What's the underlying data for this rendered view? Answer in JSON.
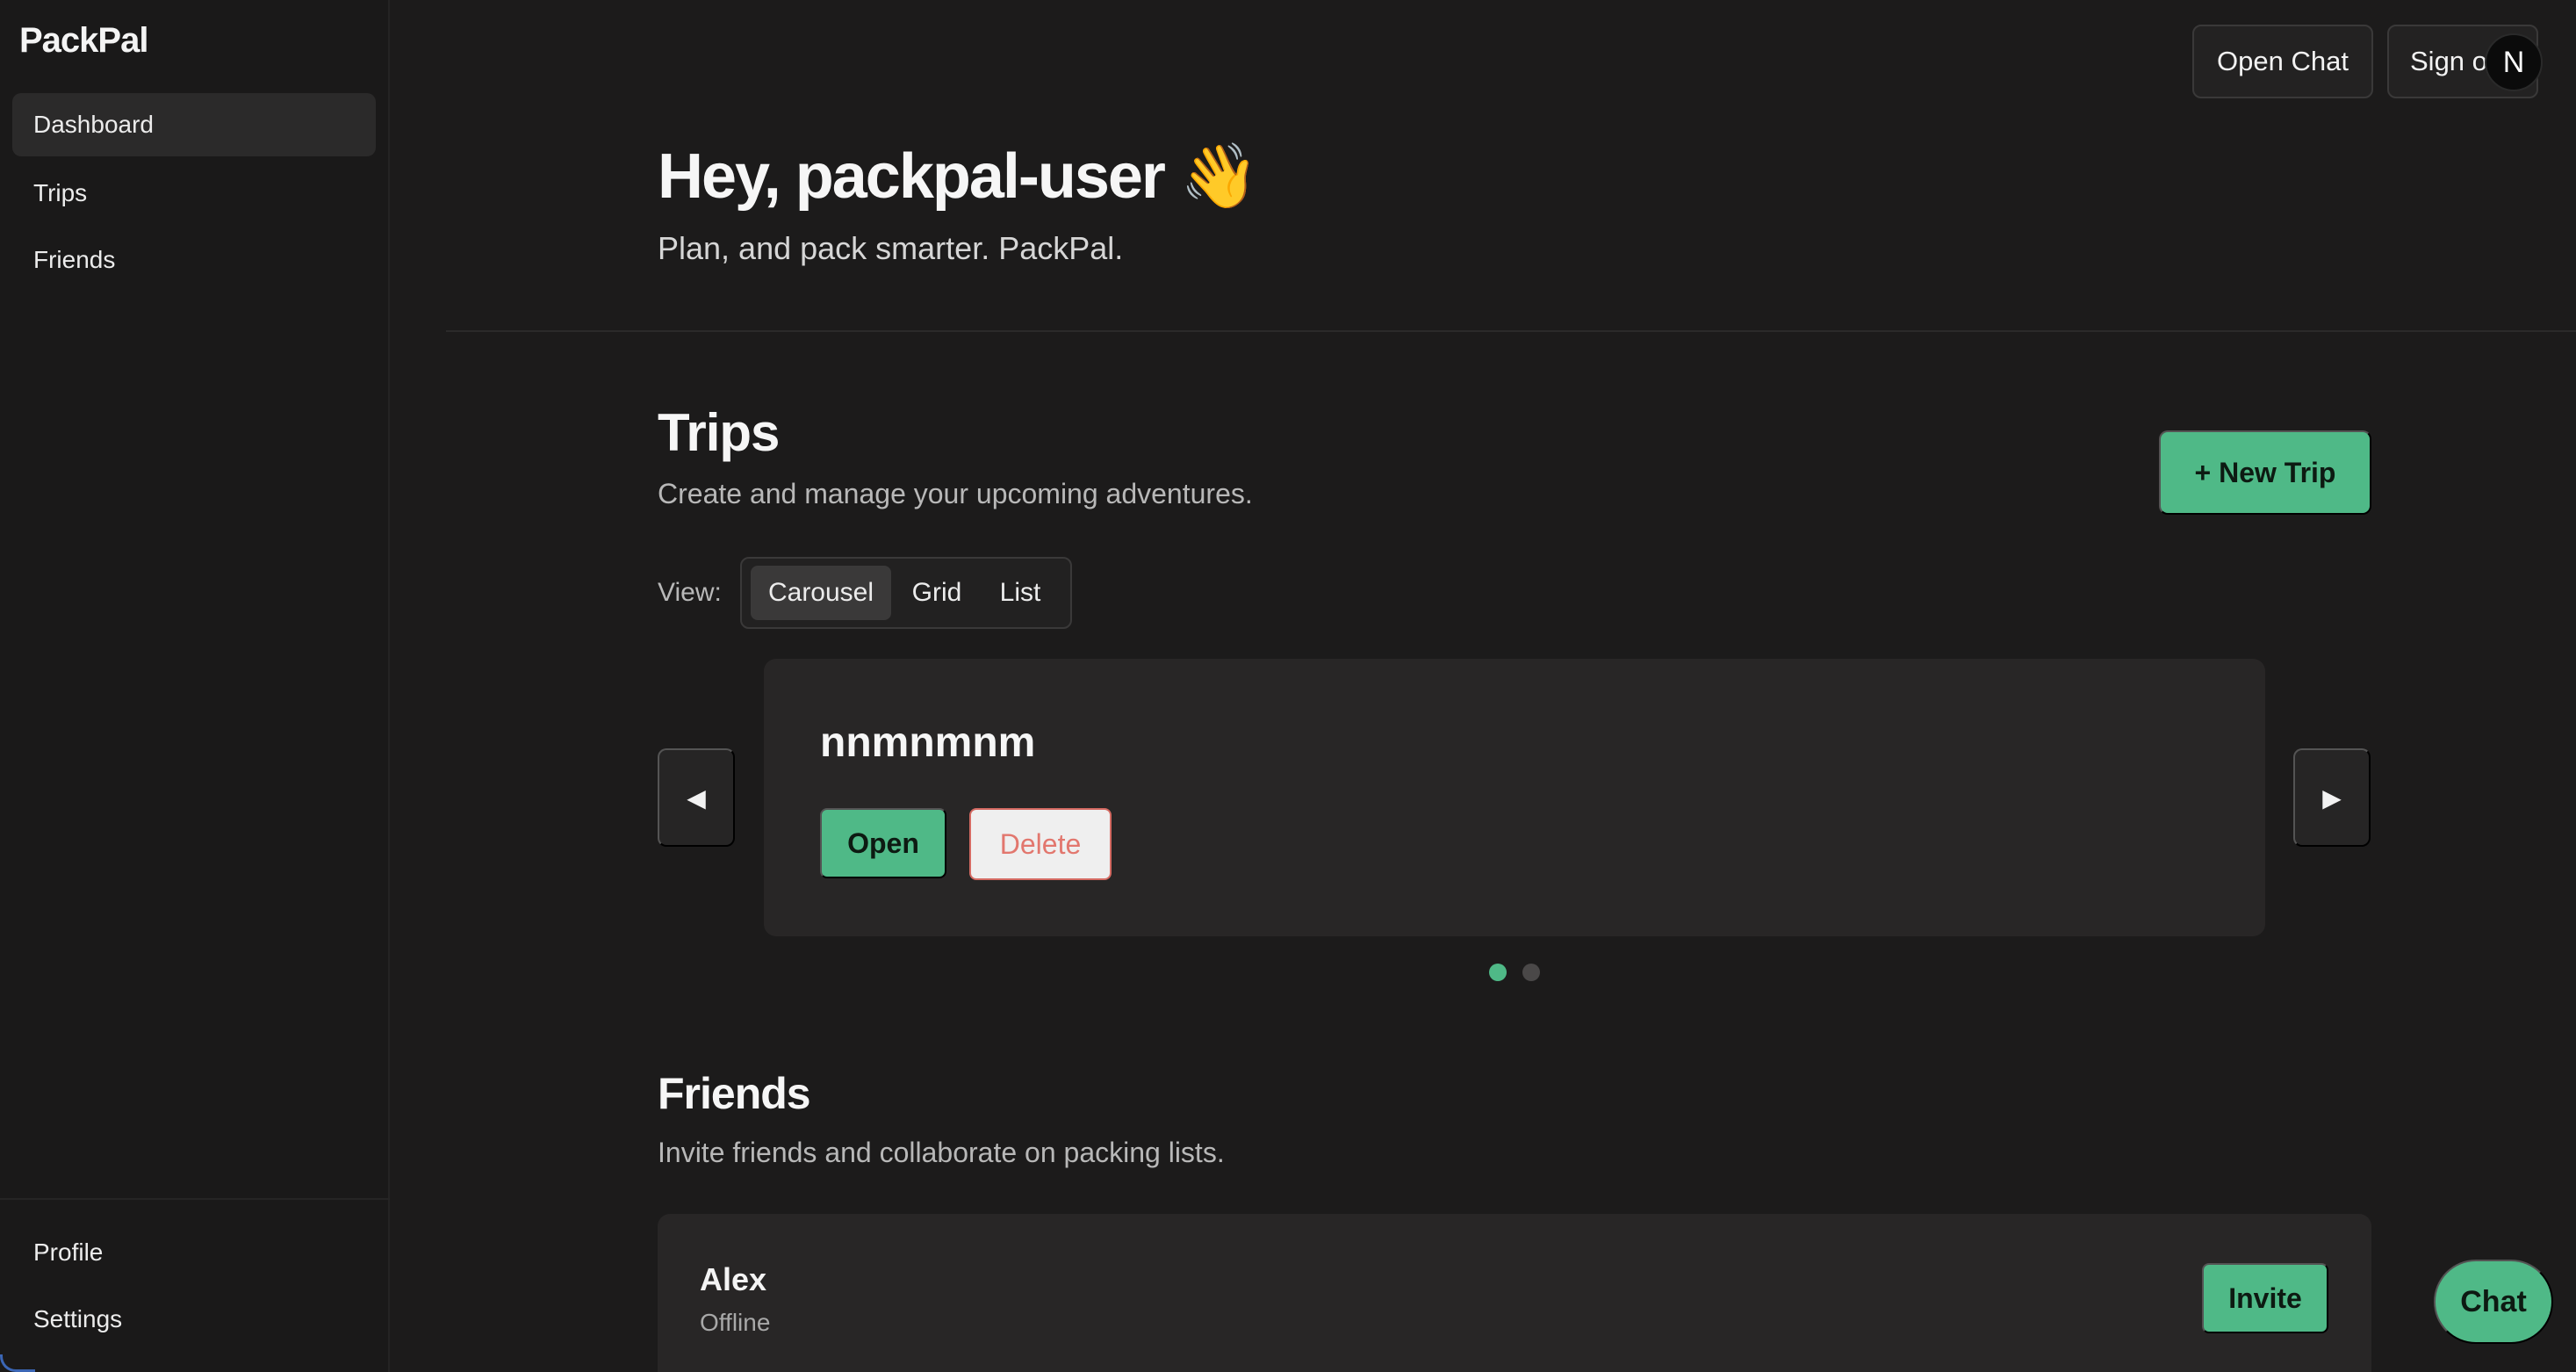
{
  "brand": "PackPal",
  "sidebar": {
    "items": [
      {
        "label": "Dashboard"
      },
      {
        "label": "Trips"
      },
      {
        "label": "Friends"
      }
    ],
    "bottom_items": [
      {
        "label": "Profile"
      },
      {
        "label": "Settings"
      }
    ]
  },
  "topbar": {
    "open_chat": "Open Chat",
    "sign_out": "Sign out",
    "avatar_initial": "N"
  },
  "header": {
    "greeting": "Hey, packpal-user 👋",
    "tagline": "Plan, and pack smarter. PackPal."
  },
  "trips": {
    "title": "Trips",
    "subtitle": "Create and manage your upcoming adventures.",
    "new_button": "+ New Trip",
    "view_label": "View:",
    "view_options": [
      "Carousel",
      "Grid",
      "List"
    ],
    "selected_view": "Carousel",
    "prev_arrow": "◀",
    "next_arrow": "▶",
    "current_trip": {
      "name": "nnmnmnm",
      "open_label": "Open",
      "delete_label": "Delete"
    },
    "pagination": {
      "total": 2,
      "active_index": 0
    }
  },
  "friends": {
    "title": "Friends",
    "subtitle": "Invite friends and collaborate on packing lists.",
    "list": [
      {
        "name": "Alex",
        "status": "Offline",
        "action": "Invite"
      }
    ]
  },
  "chat_fab": "Chat",
  "colors": {
    "accent": "#4fb987",
    "danger": "#e2776e",
    "background": "#1c1b1b",
    "card": "#282626"
  }
}
